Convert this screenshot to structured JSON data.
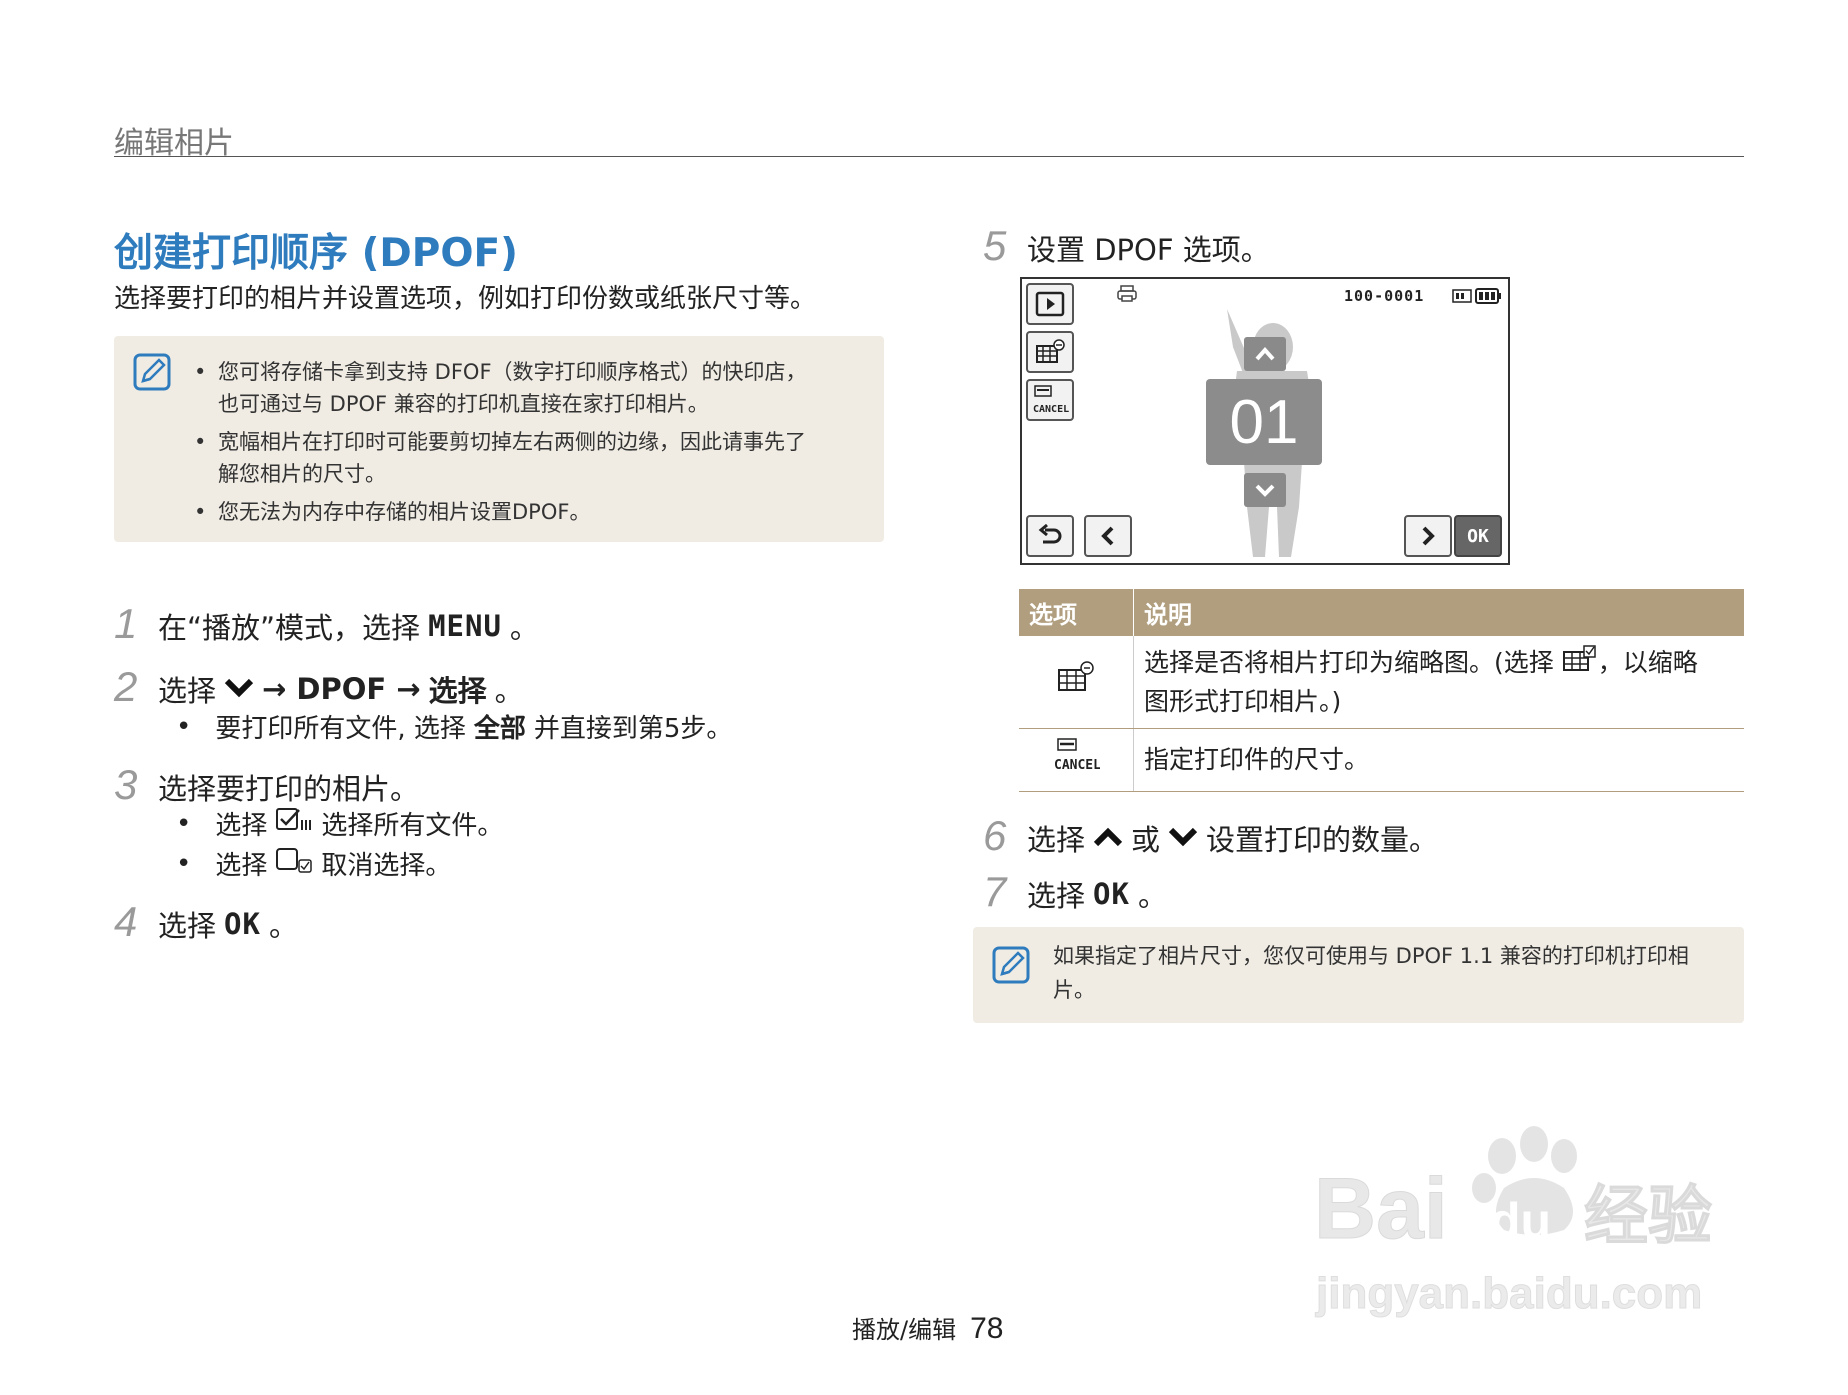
{
  "header": {
    "section_title": "编辑相片"
  },
  "main": {
    "title": "创建打印顺序 (DPOF)",
    "subtitle": "选择要打印的相片并设置选项，例如打印份数或纸张尺寸等。"
  },
  "note1": {
    "icon": "note-pencil-icon",
    "items": [
      {
        "line1": "您可将存储卡拿到支持 DFOF（数字打印顺序格式）的快印店，",
        "line2": "也可通过与 DPOF 兼容的打印机直接在家打印相片。"
      },
      {
        "line1": "宽幅相片在打印时可能要剪切掉左右两侧的边缘，因此请事先了",
        "line2": "解您相片的尺寸。"
      },
      {
        "line1": "您无法为内存中存储的相片设置DPOF。",
        "line2": ""
      }
    ]
  },
  "steps_left": [
    {
      "num": "1",
      "pre": "在“播放”模式，选择",
      "kw": "MENU",
      "post": "。"
    },
    {
      "num": "2",
      "pre": "选择",
      "mid1": "→ DPOF →",
      "bold": "选择",
      "post": "。",
      "sub": {
        "pre": "要打印所有文件, 选择",
        "bold": "全部",
        "post": "并直接到第5步。"
      }
    },
    {
      "num": "3",
      "text": "选择要打印的相片。",
      "subs": [
        {
          "pre": "选择",
          "post": "选择所有文件。"
        },
        {
          "pre": "选择",
          "post": "取消选择。"
        }
      ]
    },
    {
      "num": "4",
      "pre": "选择",
      "kw": "OK",
      "post": "。"
    }
  ],
  "step5": {
    "num": "5",
    "text": "设置 DPOF 选项。"
  },
  "camera_screen": {
    "file_number": "100-0001",
    "counter": "01",
    "ok_label": "OK",
    "cancel_label": "CANCEL"
  },
  "table": {
    "headers": [
      "选项",
      "说明"
    ],
    "rows": [
      {
        "icon": "index-print-icon",
        "desc1": "选择是否将相片打印为缩略图。(选择",
        "desc2": "，以缩略",
        "desc3": "图形式打印相片。)"
      },
      {
        "icon": "print-size-icon",
        "desc1": "指定打印件的尺寸。"
      }
    ]
  },
  "steps_right": [
    {
      "num": "6",
      "pre": "选择",
      "mid": "或",
      "post": "设置打印的数量。"
    },
    {
      "num": "7",
      "pre": "选择",
      "kw": "OK",
      "post": "。"
    }
  ],
  "note2": {
    "icon": "note-pencil-icon",
    "line1": "如果指定了相片尺寸，您仅可使用与 DPOF 1.1 兼容的打印机打印相",
    "line2": "片。"
  },
  "footer": {
    "section": "播放/编辑",
    "page": "78"
  },
  "watermark": {
    "brand": "Bai",
    "brand2": "du",
    "cn": "经验",
    "url": "jingyan.baidu.com"
  },
  "colors": {
    "title_blue": "#2e7bbd",
    "table_header": "#b09e7e",
    "note_bg": "#f0ece4"
  }
}
